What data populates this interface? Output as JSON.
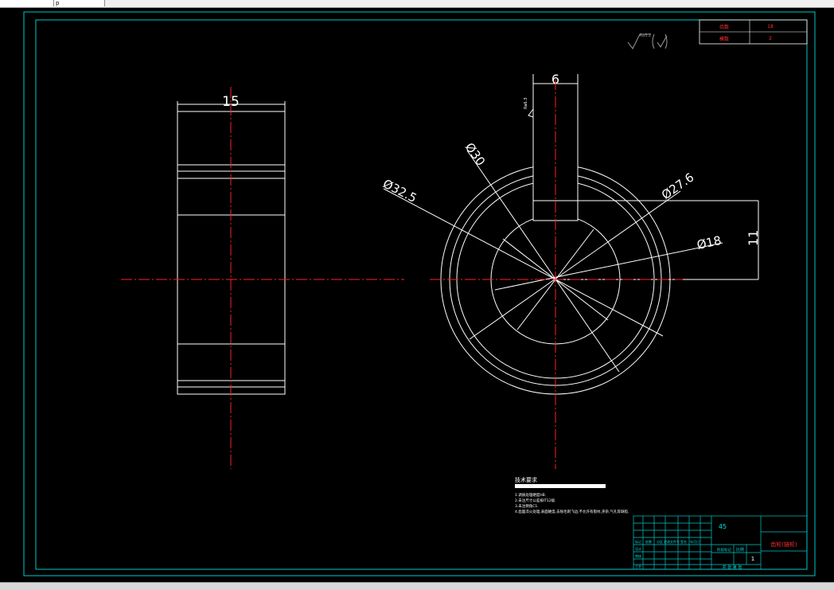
{
  "toolbar": {
    "button_1": "",
    "button_2": "p"
  },
  "colors": {
    "outline": "#ffffff",
    "frame": "#00c8c8",
    "centerline": "#ff2020",
    "table_text": "#ff3030"
  },
  "dimensions": {
    "side_width": "15",
    "keyway_width": "6",
    "d_outer": "Ø32.5",
    "d_30": "Ø30",
    "d_27_6": "Ø27.6",
    "d_18": "Ø18",
    "keyway_depth": "11"
  },
  "roughness": {
    "symbol_value": "Ra3.2",
    "local_value": "Ra6.3"
  },
  "param_table": {
    "rows": [
      {
        "label": "齿数",
        "value": "18"
      },
      {
        "label": "模数",
        "value": "2"
      }
    ]
  },
  "tech_notes": {
    "title": "技术要求",
    "lines": [
      "1.调质处理硬度HB.",
      "2.未注尺寸公差按IT12级.",
      "3.未注倒角C1.",
      "4.齿面淬火处理,表面硬度,去除毛刺飞边,不允许有裂纹,夹杂,气孔等缺陷."
    ]
  },
  "title_block": {
    "material": "45",
    "part_name": "齿轮(链轮)",
    "ratio_label": "比例",
    "scale": "1",
    "sheet_text": "共 张 第 张",
    "row_labels": [
      "标记",
      "设计",
      "审核",
      "工艺"
    ],
    "header_labels": [
      "处数",
      "分区",
      "更改文件号",
      "签名",
      "年月日"
    ],
    "stage_label": "阶段标记"
  }
}
